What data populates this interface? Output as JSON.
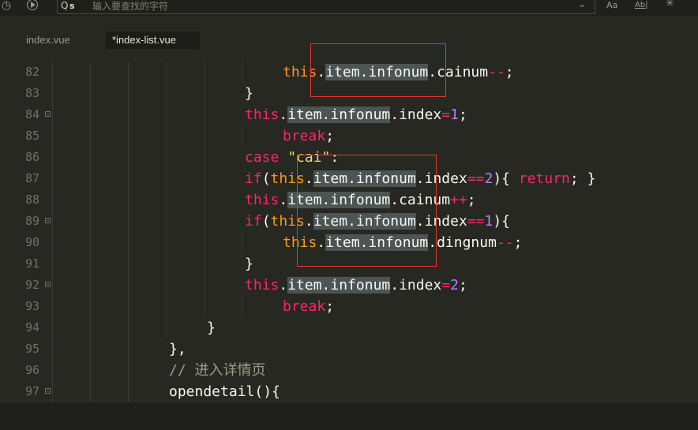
{
  "toolbar": {
    "search_placeholder": "输入要查找的字符",
    "search_glyph": "Q",
    "search_mode": "s",
    "case_label": "Aa",
    "word_label": "Ab|",
    "icons": [
      "clock-icon",
      "play-icon",
      "chevron-down-icon",
      "regex-icon"
    ]
  },
  "tabs": [
    {
      "label": "index.vue",
      "active": false
    },
    {
      "label": "*index-list.vue",
      "active": true
    }
  ],
  "lines": [
    {
      "n": "82",
      "fold": false,
      "indent": 7,
      "tokens": [
        {
          "t": "this",
          "c": "th"
        },
        {
          "t": "."
        },
        {
          "t": "item.infonum",
          "h": true
        },
        {
          "t": ".cainum"
        },
        {
          "t": "--",
          "c": "kw"
        },
        {
          "t": ";"
        }
      ]
    },
    {
      "n": "83",
      "fold": false,
      "indent": 6,
      "tokens": [
        {
          "t": "}"
        }
      ]
    },
    {
      "n": "84",
      "fold": true,
      "indent": 6,
      "tokens": [
        {
          "t": "this",
          "c": "kw"
        },
        {
          "t": "."
        },
        {
          "t": "item.infonum",
          "h": true
        },
        {
          "t": ".index"
        },
        {
          "t": "=",
          "c": "kw"
        },
        {
          "t": "1",
          "c": "num"
        },
        {
          "t": ";"
        }
      ]
    },
    {
      "n": "85",
      "fold": false,
      "indent": 7,
      "tokens": [
        {
          "t": "break",
          "c": "kw"
        },
        {
          "t": ";"
        }
      ]
    },
    {
      "n": "86",
      "fold": false,
      "indent": 6,
      "tokens": [
        {
          "t": "case",
          "c": "kw"
        },
        {
          "t": " "
        },
        {
          "t": "\"cai\"",
          "c": "str"
        },
        {
          "t": ":"
        }
      ]
    },
    {
      "n": "87",
      "fold": false,
      "indent": 6,
      "tokens": [
        {
          "t": "if",
          "c": "kw"
        },
        {
          "t": "("
        },
        {
          "t": "this",
          "c": "th"
        },
        {
          "t": "."
        },
        {
          "t": "item.infonum",
          "h": true
        },
        {
          "t": ".index"
        },
        {
          "t": "==",
          "c": "kw"
        },
        {
          "t": "2",
          "c": "num"
        },
        {
          "t": "){ "
        },
        {
          "t": "return",
          "c": "kw"
        },
        {
          "t": "; }"
        }
      ]
    },
    {
      "n": "88",
      "fold": false,
      "indent": 6,
      "tokens": [
        {
          "t": "this",
          "c": "kw"
        },
        {
          "t": "."
        },
        {
          "t": "item.infonum",
          "h": true
        },
        {
          "t": ".cainum"
        },
        {
          "t": "++",
          "c": "kw"
        },
        {
          "t": ";"
        }
      ]
    },
    {
      "n": "89",
      "fold": true,
      "indent": 6,
      "tokens": [
        {
          "t": "if",
          "c": "kw"
        },
        {
          "t": "("
        },
        {
          "t": "this",
          "c": "th"
        },
        {
          "t": "."
        },
        {
          "t": "item.infonum",
          "h": true
        },
        {
          "t": ".index"
        },
        {
          "t": "==",
          "c": "kw"
        },
        {
          "t": "1",
          "c": "num"
        },
        {
          "t": "){"
        }
      ]
    },
    {
      "n": "90",
      "fold": false,
      "indent": 7,
      "tokens": [
        {
          "t": "this",
          "c": "th"
        },
        {
          "t": "."
        },
        {
          "t": "item.infonum",
          "h": true
        },
        {
          "t": ".dingnum"
        },
        {
          "t": "--",
          "c": "kw"
        },
        {
          "t": ";"
        }
      ]
    },
    {
      "n": "91",
      "fold": false,
      "indent": 6,
      "tokens": [
        {
          "t": "}"
        }
      ]
    },
    {
      "n": "92",
      "fold": true,
      "indent": 6,
      "tokens": [
        {
          "t": "this",
          "c": "kw"
        },
        {
          "t": "."
        },
        {
          "t": "item.infonum",
          "h": true
        },
        {
          "t": ".index"
        },
        {
          "t": "=",
          "c": "kw"
        },
        {
          "t": "2",
          "c": "num"
        },
        {
          "t": ";"
        }
      ]
    },
    {
      "n": "93",
      "fold": false,
      "indent": 7,
      "tokens": [
        {
          "t": "break",
          "c": "kw"
        },
        {
          "t": ";"
        }
      ]
    },
    {
      "n": "94",
      "fold": false,
      "indent": 5,
      "tokens": [
        {
          "t": "}"
        }
      ]
    },
    {
      "n": "95",
      "fold": false,
      "indent": 4,
      "tokens": [
        {
          "t": "},"
        }
      ]
    },
    {
      "n": "96",
      "fold": false,
      "indent": 4,
      "tokens": [
        {
          "t": "// 进入详情页",
          "c": "cm"
        }
      ]
    },
    {
      "n": "97",
      "fold": true,
      "indent": 4,
      "tokens": [
        {
          "t": "opendetail(){"
        }
      ]
    }
  ],
  "colors": {
    "background": "#272822",
    "keyword": "#f92672",
    "this_keyword": "#fd971f",
    "number": "#ae81ff",
    "string": "#e6db74",
    "comment": "#a09c87",
    "selection_highlight": "#4c5554",
    "annotation_box": "#e8362c"
  }
}
